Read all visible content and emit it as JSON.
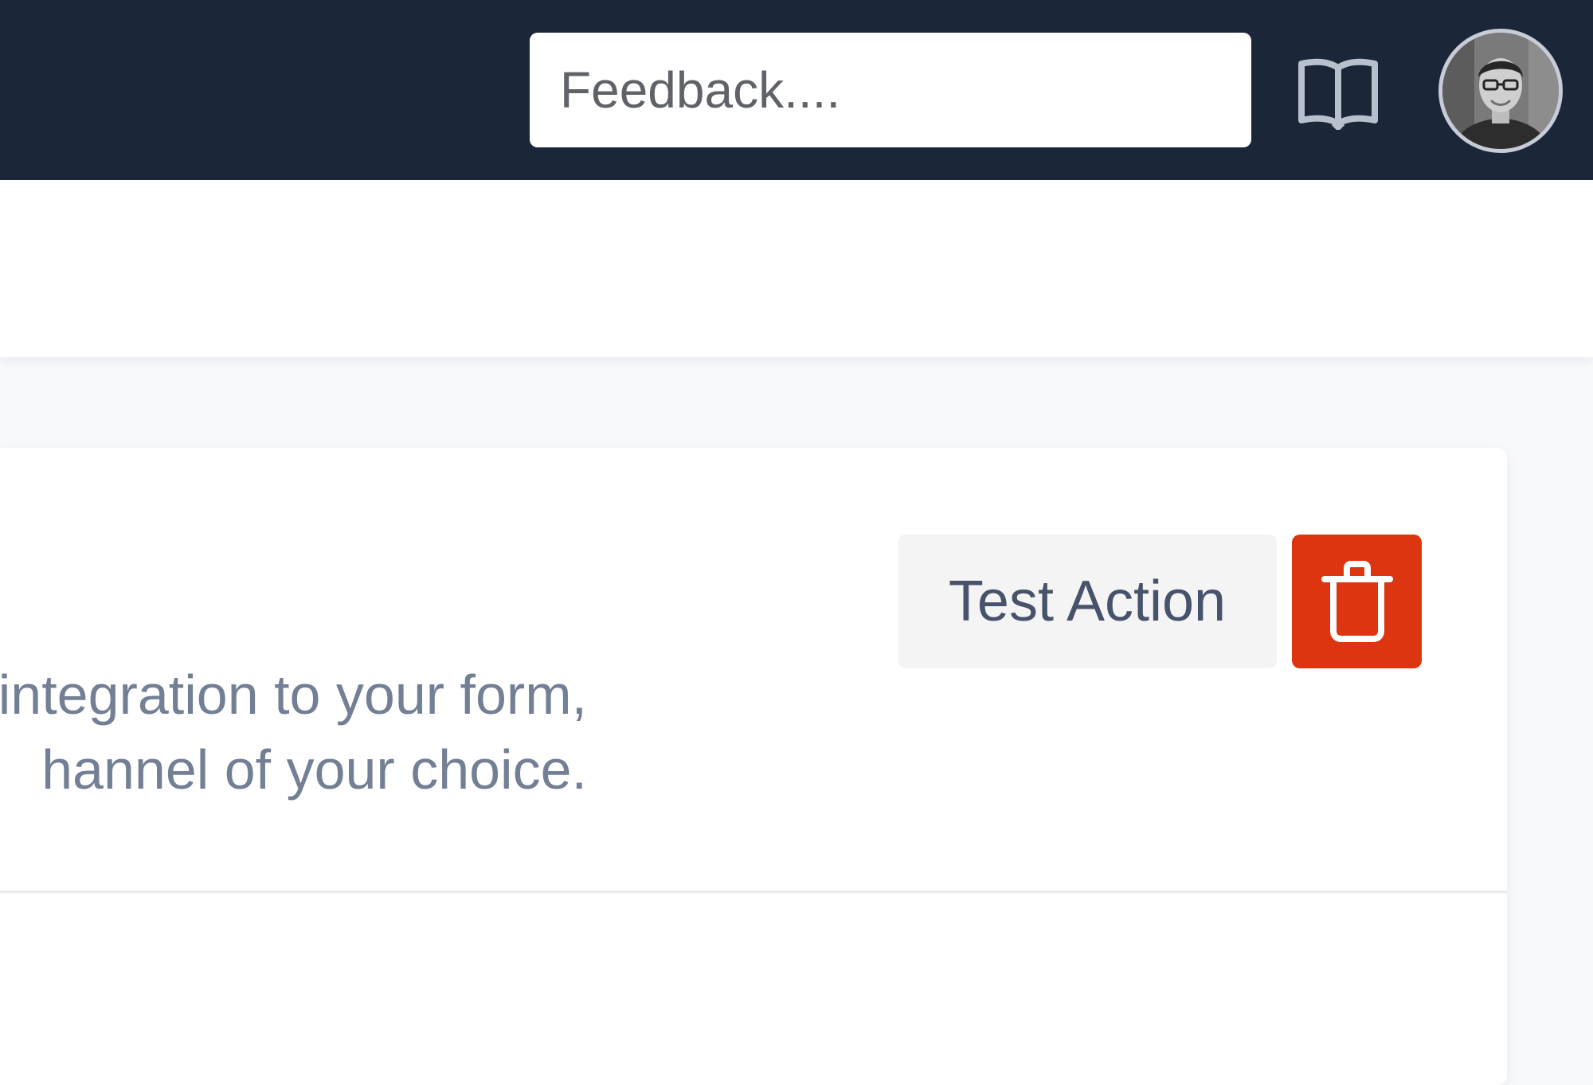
{
  "topbar": {
    "feedback_placeholder": "Feedback....",
    "docs_icon": "book-open-icon",
    "avatar_icon": "user-avatar"
  },
  "integration": {
    "description_line1": "integration to your form,",
    "description_line2": "hannel of your choice.",
    "test_action_label": "Test Action",
    "delete_icon": "trash-icon"
  },
  "colors": {
    "topbar_bg": "#1c2639",
    "delete_bg": "#dc350f",
    "secondary_button_bg": "#f4f4f5",
    "description_text": "#737f95",
    "button_text": "#47536a"
  }
}
